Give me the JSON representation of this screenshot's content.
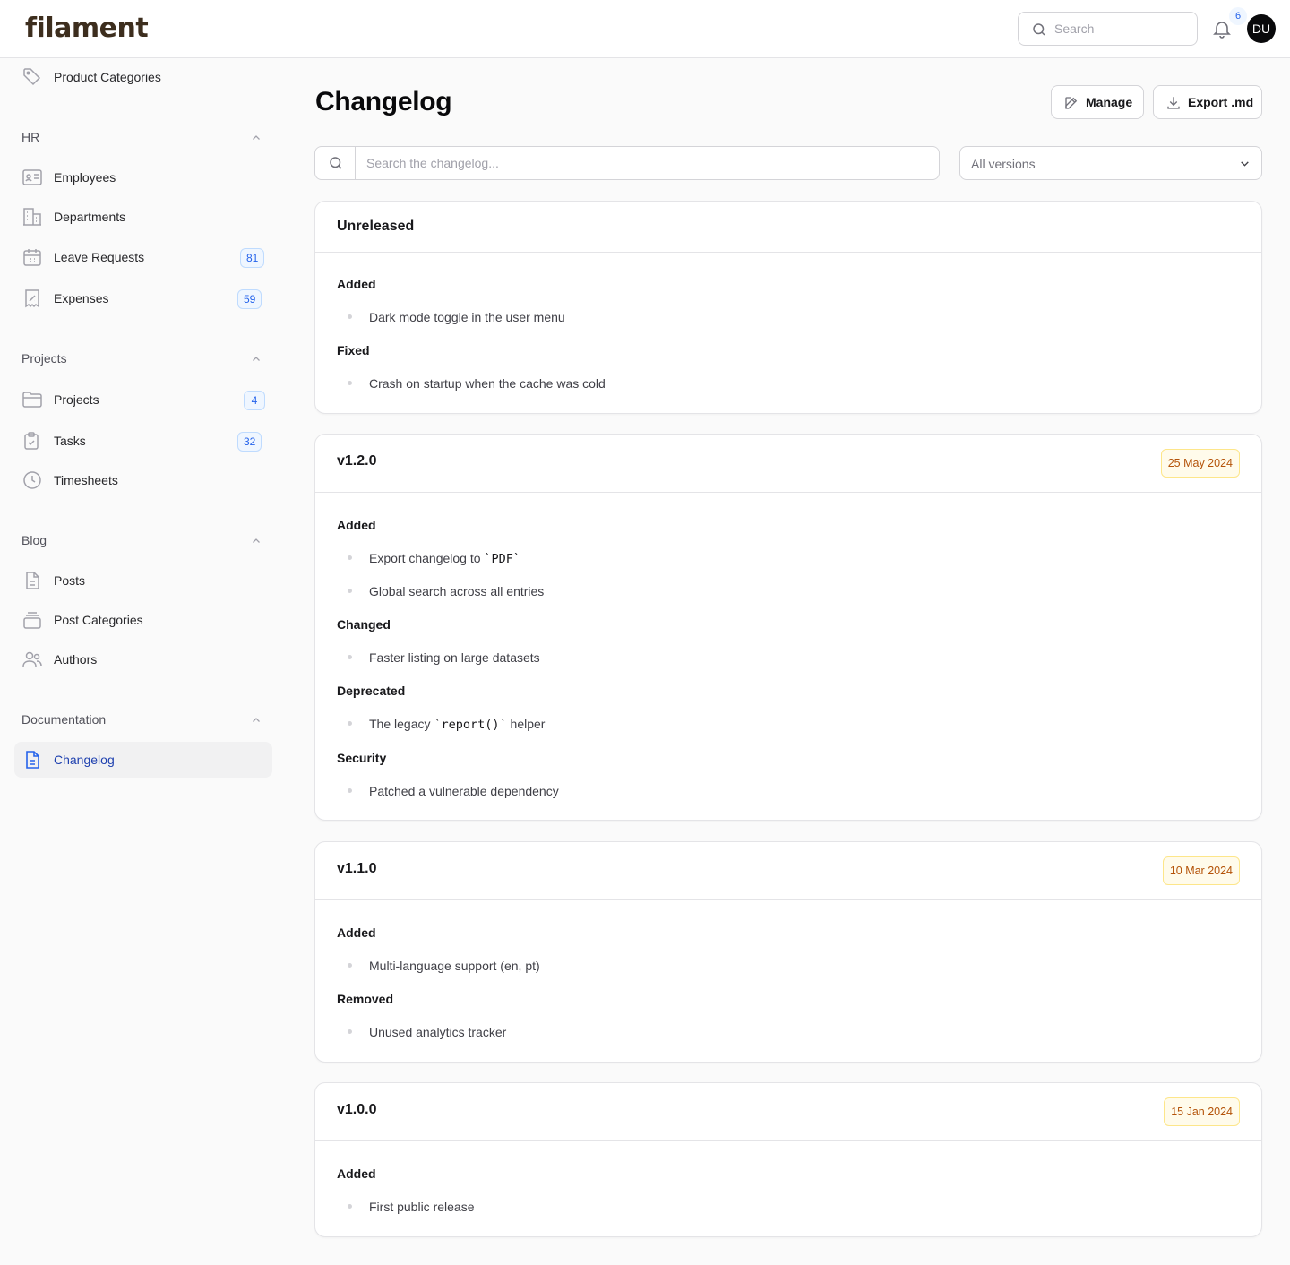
{
  "app": {
    "logo": "filament"
  },
  "topbar": {
    "search_placeholder": "Search",
    "notifications_count": "6",
    "avatar_initials": "DU"
  },
  "sidebar": {
    "top_item": "Product Categories",
    "groups": {
      "hr": {
        "label": "HR",
        "items": [
          {
            "label": "Employees",
            "icon": "id-card-icon"
          },
          {
            "label": "Departments",
            "icon": "building-icon"
          },
          {
            "label": "Leave Requests",
            "icon": "calendar-icon",
            "badge": "81"
          },
          {
            "label": "Expenses",
            "icon": "receipt-icon",
            "badge": "59"
          }
        ]
      },
      "projects": {
        "label": "Projects",
        "items": [
          {
            "label": "Projects",
            "icon": "folder-icon",
            "badge": "4"
          },
          {
            "label": "Tasks",
            "icon": "clipboard-check-icon",
            "badge": "32"
          },
          {
            "label": "Timesheets",
            "icon": "clock-icon"
          }
        ]
      },
      "blog": {
        "label": "Blog",
        "items": [
          {
            "label": "Posts",
            "icon": "document-icon"
          },
          {
            "label": "Post Categories",
            "icon": "stack-icon"
          },
          {
            "label": "Authors",
            "icon": "users-icon"
          }
        ]
      },
      "documentation": {
        "label": "Documentation",
        "items": [
          {
            "label": "Changelog",
            "icon": "document-text-icon",
            "active": true
          }
        ]
      }
    }
  },
  "page": {
    "title": "Changelog",
    "actions": {
      "manage": "Manage",
      "export": "Export .md"
    },
    "search_placeholder": "Search the changelog...",
    "version_filter": "All versions"
  },
  "releases": [
    {
      "title": "Unreleased",
      "date": "",
      "sections": [
        {
          "label": "Added",
          "items": [
            "Dark mode toggle in the user menu"
          ]
        },
        {
          "label": "Fixed",
          "items": [
            "Crash on startup when the cache was cold"
          ]
        }
      ]
    },
    {
      "title": "v1.2.0",
      "date": "25 May 2024",
      "sections": [
        {
          "label": "Added",
          "items": [
            {
              "before": "Export changelog to ",
              "code": "`PDF`",
              "after": ""
            },
            "Global search across all entries"
          ]
        },
        {
          "label": "Changed",
          "items": [
            "Faster listing on large datasets"
          ]
        },
        {
          "label": "Deprecated",
          "items": [
            {
              "before": "The legacy ",
              "code": "`report()`",
              "after": " helper"
            }
          ]
        },
        {
          "label": "Security",
          "items": [
            "Patched a vulnerable dependency"
          ]
        }
      ]
    },
    {
      "title": "v1.1.0",
      "date": "10 Mar 2024",
      "sections": [
        {
          "label": "Added",
          "items": [
            "Multi-language support (en, pt)"
          ]
        },
        {
          "label": "Removed",
          "items": [
            "Unused analytics tracker"
          ]
        }
      ]
    },
    {
      "title": "v1.0.0",
      "date": "15 Jan 2024",
      "sections": [
        {
          "label": "Added",
          "items": [
            "First public release"
          ]
        }
      ]
    }
  ],
  "colors": {
    "accent": "#2563eb",
    "active_text": "#1e40af",
    "date_badge_text": "#b45309",
    "date_badge_bg": "#fffbeb"
  }
}
